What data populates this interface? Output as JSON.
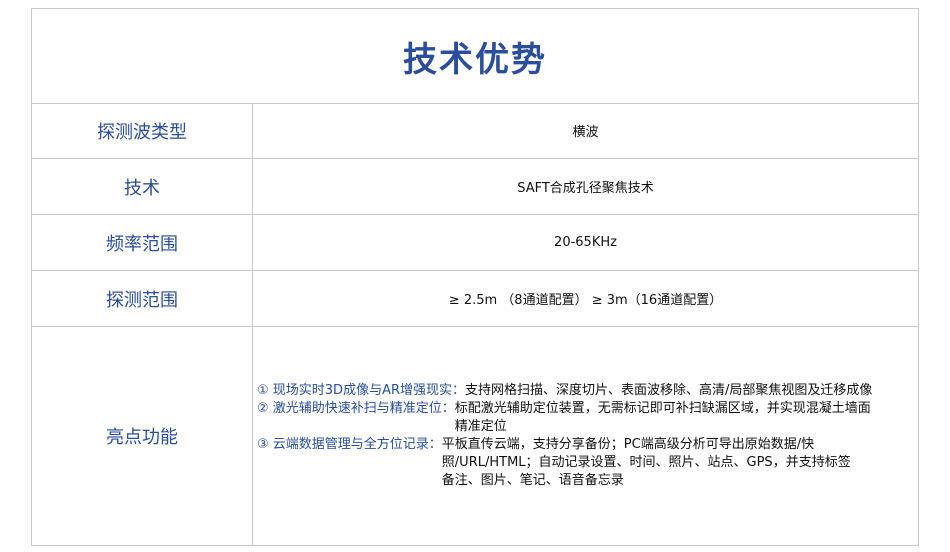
{
  "title": "技术优势",
  "rows": [
    {
      "label": "探测波类型",
      "value": "横波"
    },
    {
      "label": "技术",
      "value": "SAFT合成孔径聚焦技术"
    },
    {
      "label": "频率范围",
      "value": "20-65KHz"
    },
    {
      "label": "探测范围",
      "value": "≥ 2.5m （8通道配置） ≥ 3m（16通道配置）"
    }
  ],
  "features": {
    "label": "亮点功能",
    "items": [
      {
        "head": "① 现场实时3D成像与AR增强现实：",
        "text": "支持网格扫描、深度切片、表面波移除、高清/局部聚焦视图及迁移成像"
      },
      {
        "head": "② 激光辅助快速补扫与精准定位：",
        "text": "标配激光辅助定位装置，无需标记即可补扫缺漏区域，并实现混凝土墙面精准定位"
      },
      {
        "head": "③ 云端数据管理与全方位记录：",
        "text": "平板直传云端，支持分享备份；PC端高级分析可导出原始数据/快照/URL/HTML；自动记录设置、时间、照片、站点、GPS，并支持标签备注、图片、笔记、语音备忘录"
      }
    ]
  }
}
